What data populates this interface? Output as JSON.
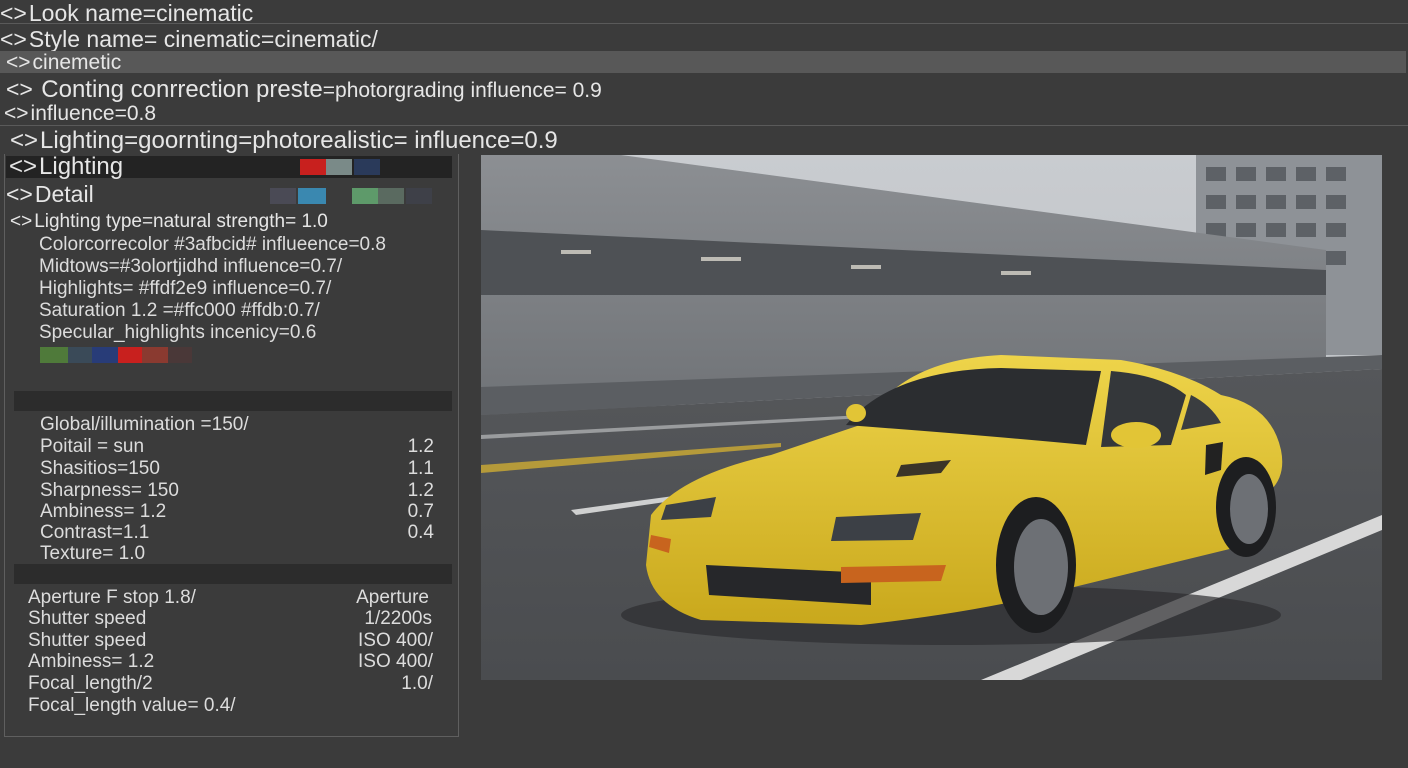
{
  "header": {
    "look": "Look name=cinematic",
    "style": "Style name=  cinematic=cinematic/",
    "selected": "cinemetic",
    "grading_prefix": "Conting conrrection preste",
    "grading_suffix": "=photorgrading influence= 0.9",
    "influence": "influence=0.8",
    "lighting_line": "Lighting=goornting=photorealistic= influence=0.9"
  },
  "tabs": {
    "lighting": "Lighting",
    "detail": "Detail"
  },
  "lighting_params": [
    "Lighting type=natural strength= 1.0",
    "Colorcorrecolor #3afbcid# influeence=0.8",
    "Midtows=#3olortjidhd influence=0.7/",
    "Highlights= #ffdf2e9 influence=0.7/",
    "Saturation 1.2 =#ffc000 #ffdb:0.7/",
    "Specular_highlights incenicy=0.6"
  ],
  "render_params": [
    {
      "label": "Global/illumination =150/",
      "value": ""
    },
    {
      "label": "Poitail = sun",
      "value": "1.2"
    },
    {
      "label": "Shasitios=150",
      "value": "1.1"
    },
    {
      "label": "Sharpness= 150",
      "value": "1.2"
    },
    {
      "label": "Ambiness= 1.2",
      "value": "0.7"
    },
    {
      "label": "Contrast=1.1",
      "value": "0.4"
    },
    {
      "label": "Texture= 1.0",
      "value": ""
    }
  ],
  "camera_params": [
    {
      "label": "Aperture F stop  1.8/",
      "value": "Aperture"
    },
    {
      "label": "Shutter speed",
      "value": "1/2200s"
    },
    {
      "label": "Shutter speed",
      "value": "ISO 400/"
    },
    {
      "label": "Ambiness= 1.2",
      "value": "ISO 400/"
    },
    {
      "label": "Focal_length/2",
      "value": "1.0/"
    },
    {
      "label": "Focal_length value= 0.4/",
      "value": ""
    }
  ],
  "colors": {
    "background": "#3b3b3b",
    "accent_red": "#c8201e",
    "car_yellow": "#e3c52a"
  }
}
